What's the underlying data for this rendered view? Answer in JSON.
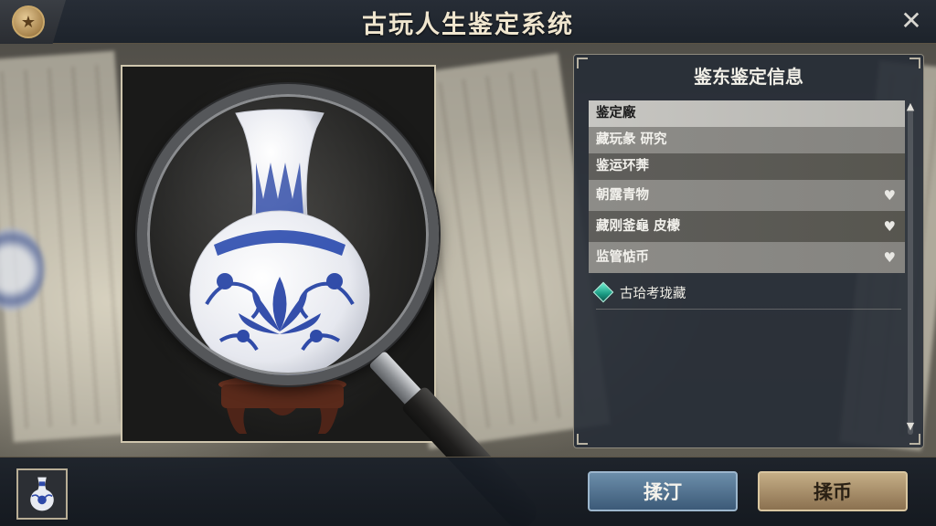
{
  "header": {
    "title": "古玩人生鉴定系统",
    "badge_icon": "star-medal-icon",
    "close_icon": "close-icon"
  },
  "info_panel": {
    "title": "鉴东鉴定信息",
    "items": [
      {
        "label": "鉴定廠",
        "favorite": false
      },
      {
        "label": "藏玩彖 研究",
        "favorite": false
      },
      {
        "label": "鉴运环莾",
        "favorite": false
      },
      {
        "label": "朝露青物",
        "favorite": true
      },
      {
        "label": "藏刚釜龜 皮檬",
        "favorite": true
      },
      {
        "label": "监管惦币",
        "favorite": true
      }
    ],
    "extra_item": {
      "label": "古珨考珑藏",
      "icon": "green-gem-icon"
    }
  },
  "bottom": {
    "thumbnail_icon": "blue-white-vase-icon",
    "btn_left_label": "揉汀",
    "btn_right_label": "揉币"
  },
  "colors": {
    "header_bg": "#1d232b",
    "title_text": "#f0e6cf",
    "panel_bg": "#262c36",
    "btn_blue": "#4d6d8c",
    "btn_gold": "#a88f68",
    "gem": "#1a9a83"
  }
}
